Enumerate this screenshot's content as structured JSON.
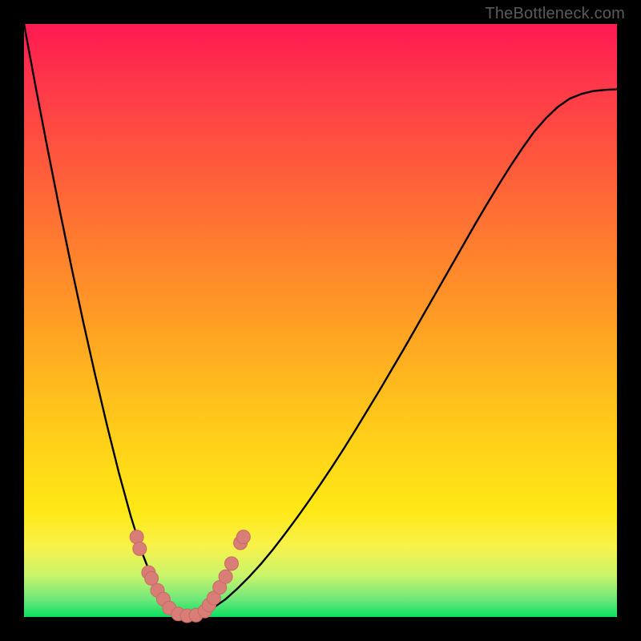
{
  "watermark_text": "TheBottleneck.com",
  "colors": {
    "background": "#000000",
    "gradient_top": "#ff1a52",
    "gradient_bottom": "#0ae060",
    "curve": "#000000",
    "marker_fill": "#d97d77",
    "marker_stroke": "#c86a64"
  },
  "chart_data": {
    "type": "line",
    "title": "",
    "xlabel": "",
    "ylabel": "",
    "xlim": [
      0,
      100
    ],
    "ylim": [
      0,
      100
    ],
    "x": [
      0,
      2,
      4,
      6,
      8,
      10,
      12,
      14,
      16,
      18,
      20,
      22,
      24,
      26,
      28,
      30,
      32,
      34,
      36,
      38,
      40,
      42,
      44,
      46,
      48,
      50,
      52,
      54,
      56,
      58,
      60,
      62,
      64,
      66,
      68,
      70,
      72,
      74,
      76,
      78,
      80,
      82,
      84,
      86,
      88,
      90,
      92,
      94,
      96,
      98,
      100
    ],
    "series": [
      {
        "name": "bottleneck-curve",
        "values": [
          100,
          89.2,
          78.8,
          68.7,
          59.0,
          49.7,
          40.8,
          32.3,
          24.3,
          17.0,
          10.6,
          5.5,
          2.1,
          0.3,
          0.0,
          0.5,
          1.6,
          3.0,
          4.8,
          6.8,
          9.0,
          11.4,
          14.0,
          16.7,
          19.5,
          22.4,
          25.4,
          28.5,
          31.7,
          35.0,
          38.3,
          41.7,
          45.1,
          48.6,
          52.1,
          55.6,
          59.1,
          62.6,
          66.1,
          69.5,
          72.8,
          76.0,
          79.0,
          81.8,
          84.1,
          86.0,
          87.4,
          88.2,
          88.7,
          88.9,
          89.0
        ]
      }
    ],
    "marker_points": [
      {
        "x": 19.0,
        "y": 13.5
      },
      {
        "x": 19.5,
        "y": 11.5
      },
      {
        "x": 21.0,
        "y": 7.5
      },
      {
        "x": 21.5,
        "y": 6.5
      },
      {
        "x": 22.5,
        "y": 4.5
      },
      {
        "x": 23.5,
        "y": 3.0
      },
      {
        "x": 24.5,
        "y": 1.5
      },
      {
        "x": 26.0,
        "y": 0.5
      },
      {
        "x": 27.5,
        "y": 0.2
      },
      {
        "x": 29.0,
        "y": 0.3
      },
      {
        "x": 30.5,
        "y": 1.0
      },
      {
        "x": 31.2,
        "y": 2.0
      },
      {
        "x": 32.0,
        "y": 3.2
      },
      {
        "x": 33.0,
        "y": 5.0
      },
      {
        "x": 34.0,
        "y": 6.8
      },
      {
        "x": 35.0,
        "y": 9.0
      },
      {
        "x": 36.5,
        "y": 12.5
      },
      {
        "x": 37.0,
        "y": 13.5
      }
    ]
  }
}
